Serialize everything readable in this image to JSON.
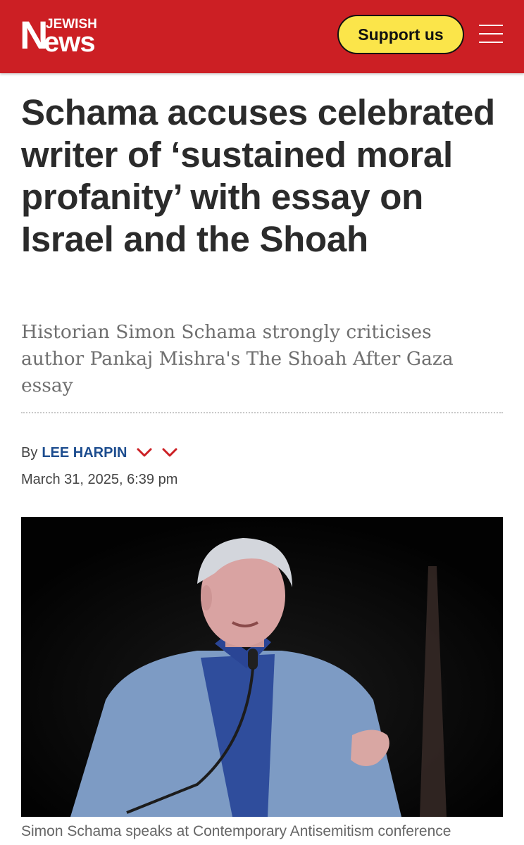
{
  "header": {
    "logo_top": "JEWISH",
    "logo_n": "N",
    "logo_rest": "ews",
    "support_label": "Support us",
    "menu_icon": "hamburger-icon",
    "brand_color": "#cc1f24",
    "button_color": "#fbe54a"
  },
  "article": {
    "headline": "Schama accuses celebrated writer of ‘sustained moral profanity’ with essay on Israel and the Shoah",
    "standfirst": "Historian Simon Schama strongly criticises author Pankaj Mishra's The Shoah After Gaza essay",
    "byline_prefix": "By",
    "author": "LEE HARPIN",
    "byline_icons": [
      "chevron-down-icon",
      "chevron-down-icon"
    ],
    "date": "March 31, 2025, 6:39 pm",
    "caption": "Simon Schama speaks at Contemporary Antisemitism conference",
    "author_color": "#1d4d8f"
  }
}
